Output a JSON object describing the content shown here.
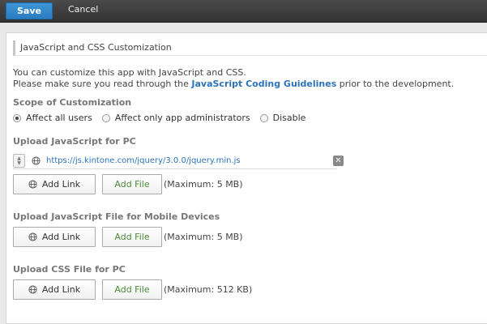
{
  "toolbar": {
    "save_label": "Save",
    "cancel_label": "Cancel"
  },
  "section": {
    "title": "JavaScript and CSS Customization"
  },
  "intro": {
    "line1": "You can customize this app with JavaScript and CSS.",
    "line2_before": "Please make sure you read through the ",
    "line2_link": "JavaScript Coding Guidelines",
    "line2_after": " prior to the development."
  },
  "scope": {
    "label": "Scope of Customization",
    "options": [
      {
        "label": "Affect all users",
        "selected": true
      },
      {
        "label": "Affect only app administrators",
        "selected": false
      },
      {
        "label": "Disable",
        "selected": false
      }
    ]
  },
  "upload_js_pc": {
    "label": "Upload JavaScript for PC",
    "files": [
      {
        "url": "https://js.kintone.com/jquery/3.0.0/jquery.min.js"
      }
    ],
    "add_link": "Add Link",
    "add_file": "Add File",
    "max_note": "(Maximum: 5 MB)"
  },
  "upload_js_mobile": {
    "label": "Upload JavaScript File for Mobile Devices",
    "add_link": "Add Link",
    "add_file": "Add File",
    "max_note": "(Maximum: 5 MB)"
  },
  "upload_css_pc": {
    "label": "Upload CSS File for PC",
    "add_link": "Add Link",
    "add_file": "Add File",
    "max_note": "(Maximum: 512 KB)"
  },
  "colors": {
    "accent": "#2d73b8",
    "save": "#2b7bc0",
    "add_file_text": "#4d8a3a"
  },
  "icons": [
    "globe-icon",
    "drag-handle-icon",
    "remove-icon"
  ]
}
